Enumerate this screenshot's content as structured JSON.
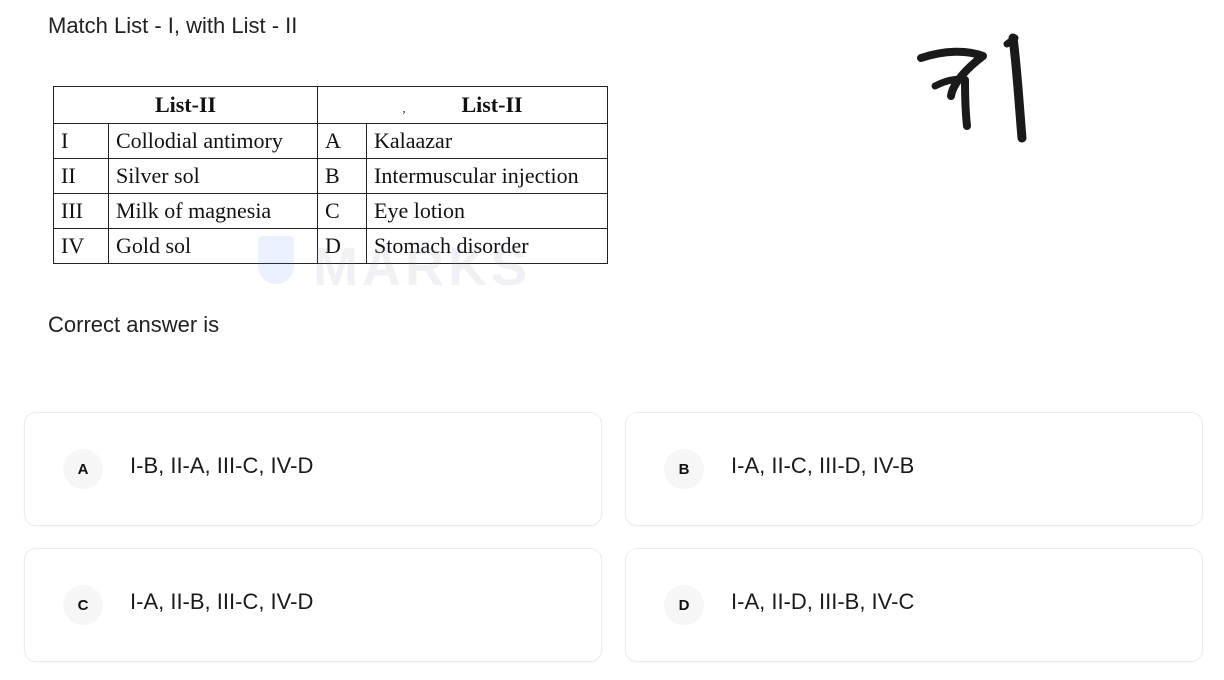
{
  "question": "Match List - I, with List - II",
  "handwritten_number": "71",
  "watermark_text": "MARKS",
  "table": {
    "header_left": "List-II",
    "header_mark": ",",
    "header_right": "List-II",
    "rows": [
      {
        "num": "I",
        "item": "Collodial antimory",
        "letter": "A",
        "match": "Kalaazar"
      },
      {
        "num": "II",
        "item": "Silver sol",
        "letter": "B",
        "match": "Intermuscular injection"
      },
      {
        "num": "III",
        "item": "Milk of magnesia",
        "letter": "C",
        "match": "Eye lotion"
      },
      {
        "num": "IV",
        "item": "Gold sol",
        "letter": "D",
        "match": "Stomach disorder"
      }
    ]
  },
  "prompt": "Correct answer is",
  "options": [
    {
      "letter": "A",
      "text": "I-B, II-A, III-C, IV-D"
    },
    {
      "letter": "B",
      "text": "I-A, II-C, III-D, IV-B"
    },
    {
      "letter": "C",
      "text": "I-A, II-B, III-C, IV-D"
    },
    {
      "letter": "D",
      "text": "I-A, II-D, III-B, IV-C"
    }
  ],
  "colors": {
    "text": "#1f1f1f",
    "card_border": "#ececec",
    "badge_bg": "#f6f6f6",
    "ink": "#111111"
  }
}
